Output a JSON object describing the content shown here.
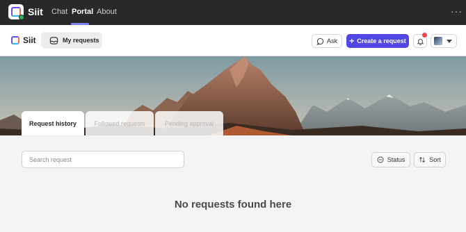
{
  "topbar": {
    "app_name": "Siit",
    "tabs": [
      {
        "label": "Chat"
      },
      {
        "label": "Portal"
      },
      {
        "label": "About"
      }
    ],
    "active_tab": "Portal",
    "more_icon": "ellipsis-icon"
  },
  "header": {
    "brand_name": "Siit",
    "my_requests_label": "My requests",
    "ask_label": "Ask",
    "create_label": "Create a request",
    "accent_color": "#4f46e5",
    "notification_dot_color": "#ef4444"
  },
  "tabs": [
    {
      "label": "Request history",
      "active": true
    },
    {
      "label": "Followed requests",
      "active": false
    },
    {
      "label": "Pending approval",
      "active": false
    }
  ],
  "search": {
    "placeholder": "Search request",
    "value": ""
  },
  "filters": {
    "status_label": "Status",
    "sort_label": "Sort"
  },
  "empty_state": {
    "message": "No requests found here"
  }
}
